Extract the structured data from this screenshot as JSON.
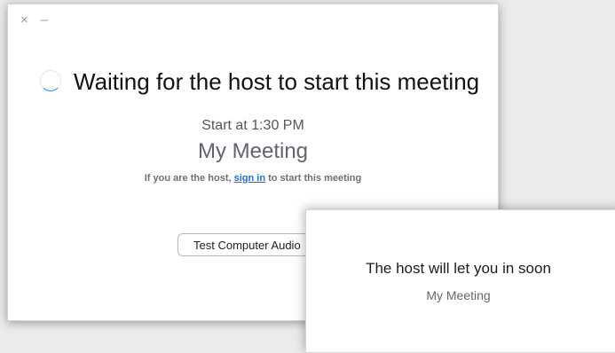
{
  "main_window": {
    "controls": {
      "close": "×",
      "minimize": "–"
    },
    "heading": "Waiting for the host to start this meeting",
    "start_time": "Start at 1:30 PM",
    "meeting_title": "My Meeting",
    "host_prompt": {
      "prefix": "If you are the host, ",
      "link": "sign in",
      "suffix": " to start this meeting"
    },
    "test_audio_button": "Test Computer Audio"
  },
  "overlay_window": {
    "heading": "The host will let you in soon",
    "meeting_title": "My Meeting"
  },
  "colors": {
    "link": "#1a73d9",
    "spinner_accent": "#2d8cff"
  },
  "icons": {
    "spinner": "loading-spinner-icon",
    "close": "close-icon",
    "minimize": "minimize-icon"
  }
}
